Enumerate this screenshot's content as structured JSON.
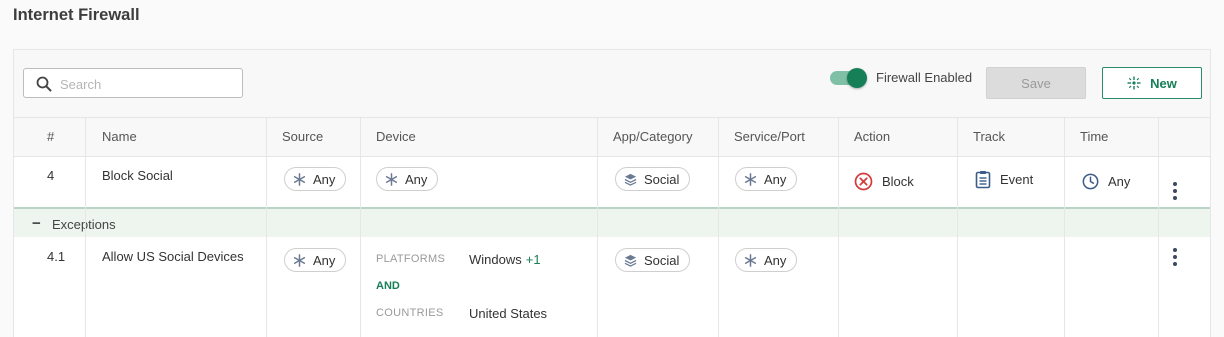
{
  "page": {
    "title": "Internet Firewall"
  },
  "toolbar": {
    "search_placeholder": "Search",
    "search_value": "",
    "firewall_enabled_label": "Firewall Enabled",
    "firewall_enabled": true,
    "save_label": "Save",
    "new_label": "New"
  },
  "columns": {
    "num": "#",
    "name": "Name",
    "source": "Source",
    "device": "Device",
    "app": "App/Category",
    "service": "Service/Port",
    "action": "Action",
    "track": "Track",
    "time": "Time"
  },
  "rule": {
    "num": "4",
    "name": "Block Social",
    "source": "Any",
    "device": "Any",
    "app": "Social",
    "service": "Any",
    "action": "Block",
    "track": "Event",
    "time": "Any"
  },
  "exceptions": {
    "label": "Exceptions",
    "collapse_symbol": "−",
    "row": {
      "num": "4.1",
      "name": "Allow US Social Devices",
      "source": "Any",
      "device": {
        "platforms_key": "PLATFORMS",
        "platforms_value": "Windows",
        "platforms_more": "+1",
        "and_label": "AND",
        "countries_key": "COUNTRIES",
        "countries_value": "United States"
      },
      "app": "Social",
      "service": "Any"
    }
  },
  "colors": {
    "accent": "#167f58",
    "toggle_track": "#7fc0a6",
    "block_red": "#d63a3a",
    "icon_blue": "#3b5b8a",
    "exceptions_bg": "#edf5ee"
  },
  "icons": {
    "search": "search-icon",
    "new": "crosshair-sparkle-icon",
    "any": "asterisk-icon",
    "category": "layers-icon",
    "block": "x-circle-icon",
    "track": "clipboard-icon",
    "time": "clock-icon",
    "menu": "kebab-menu-icon"
  }
}
